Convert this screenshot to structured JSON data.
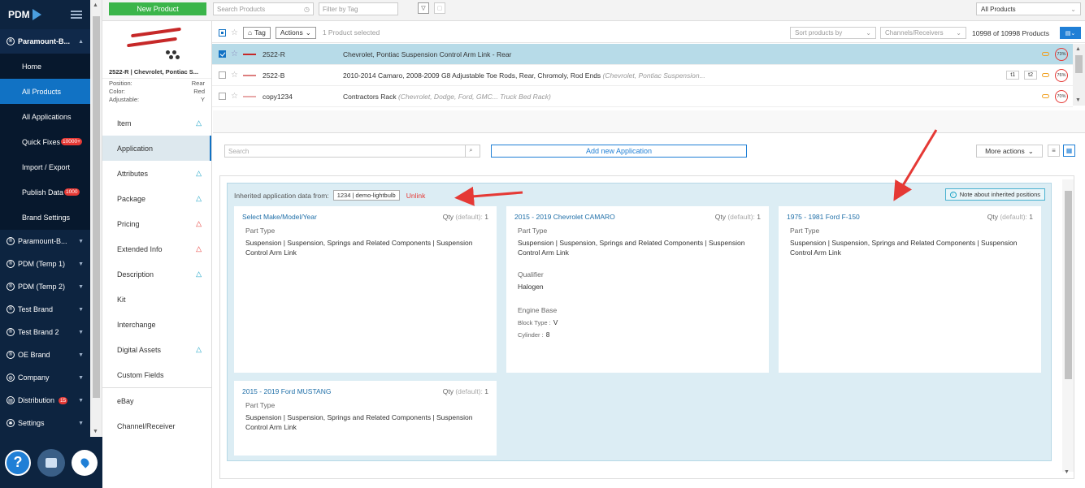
{
  "sidebar": {
    "logo": "PDM",
    "active_brand": "Paramount-B...",
    "subnav": [
      "Home",
      "All Products",
      "All Applications",
      "Quick Fixes",
      "Import / Export",
      "Publish Data",
      "Brand Settings"
    ],
    "quick_fixes_badge": "10000+",
    "publish_badge": "1000",
    "brands": [
      "Paramount-B...",
      "PDM (Temp 1)",
      "PDM (Temp 2)",
      "Test Brand",
      "Test Brand 2",
      "OE Brand",
      "Company",
      "Distribution",
      "Settings"
    ],
    "distribution_badge": "15"
  },
  "topbar": {
    "new_product": "New Product",
    "search_placeholder": "Search Products",
    "tag_placeholder": "Filter by Tag",
    "scope": "All Products"
  },
  "preview": {
    "title": "2522-R | Chevrolet, Pontiac S...",
    "specs": [
      {
        "label": "Position:",
        "value": "Rear"
      },
      {
        "label": "Color:",
        "value": "Red"
      },
      {
        "label": "Adjustable:",
        "value": "Y"
      }
    ]
  },
  "listbar": {
    "tag_label": "Tag",
    "actions_label": "Actions",
    "selected_text": "1 Product selected",
    "sort_placeholder": "Sort products by",
    "channels_placeholder": "Channels/Receivers",
    "count": "10998 of 10998 Products"
  },
  "products": [
    {
      "sku": "2522-R",
      "desc": "Chevrolet, Pontiac Suspension Control Arm Link - Rear",
      "extra": "",
      "health": "73%"
    },
    {
      "sku": "2522-B",
      "desc": "2010-2014 Camaro, 2008-2009 G8 Adjustable Toe Rods, Rear, Chromoly, Rod Ends ",
      "extra": "(Chevrolet, Pontiac Suspension...",
      "health": "76%",
      "tags": [
        "t1",
        "t2"
      ]
    },
    {
      "sku": "copy1234",
      "desc": "Contractors Rack ",
      "extra": "(Chevrolet, Dodge, Ford, GMC... Truck Bed Rack)",
      "health": "70%"
    }
  ],
  "sections": [
    "Item",
    "Application",
    "Attributes",
    "Package",
    "Pricing",
    "Extended Info",
    "Description",
    "Kit",
    "Interchange",
    "Digital Assets",
    "Custom Fields",
    "eBay",
    "Channel/Receiver"
  ],
  "main": {
    "search_placeholder": "Search",
    "add_application": "Add new Application",
    "more_actions": "More actions",
    "inherited_label": "Inherited application data from:",
    "inherited_source": "1234 | demo-lightbulb",
    "unlink": "Unlink",
    "note": "Note about inherited positions"
  },
  "cards": [
    {
      "title": "Select Make/Model/Year",
      "qty_label": "Qty",
      "qty_default": "(default):",
      "qty": "1",
      "part_type_label": "Part Type",
      "part_type": "Suspension | Suspension, Springs and Related Components | Suspension Control Arm Link"
    },
    {
      "title": "2015 - 2019 Chevrolet CAMARO",
      "qty_label": "Qty",
      "qty_default": "(default):",
      "qty": "1",
      "part_type_label": "Part Type",
      "part_type": "Suspension | Suspension, Springs and Related Components | Suspension Control Arm Link",
      "qualifier_label": "Qualifier",
      "qualifier": "Halogen",
      "engine_label": "Engine Base",
      "block_label": "Block Type :",
      "block": "V",
      "cyl_label": "Cylinder :",
      "cyl": "8"
    },
    {
      "title": "1975 - 1981 Ford F-150",
      "qty_label": "Qty",
      "qty_default": "(default):",
      "qty": "1",
      "part_type_label": "Part Type",
      "part_type": "Suspension | Suspension, Springs and Related Components | Suspension Control Arm Link"
    },
    {
      "title": "2015 - 2019 Ford MUSTANG",
      "qty_label": "Qty",
      "qty_default": "(default):",
      "qty": "1",
      "part_type_label": "Part Type",
      "part_type": "Suspension | Suspension, Springs and Related Components | Suspension Control Arm Link"
    }
  ],
  "colors": {
    "sidebar": "#0d2440",
    "accent": "#1172c4",
    "green": "#3bb54a",
    "annotation": "#e53935"
  }
}
